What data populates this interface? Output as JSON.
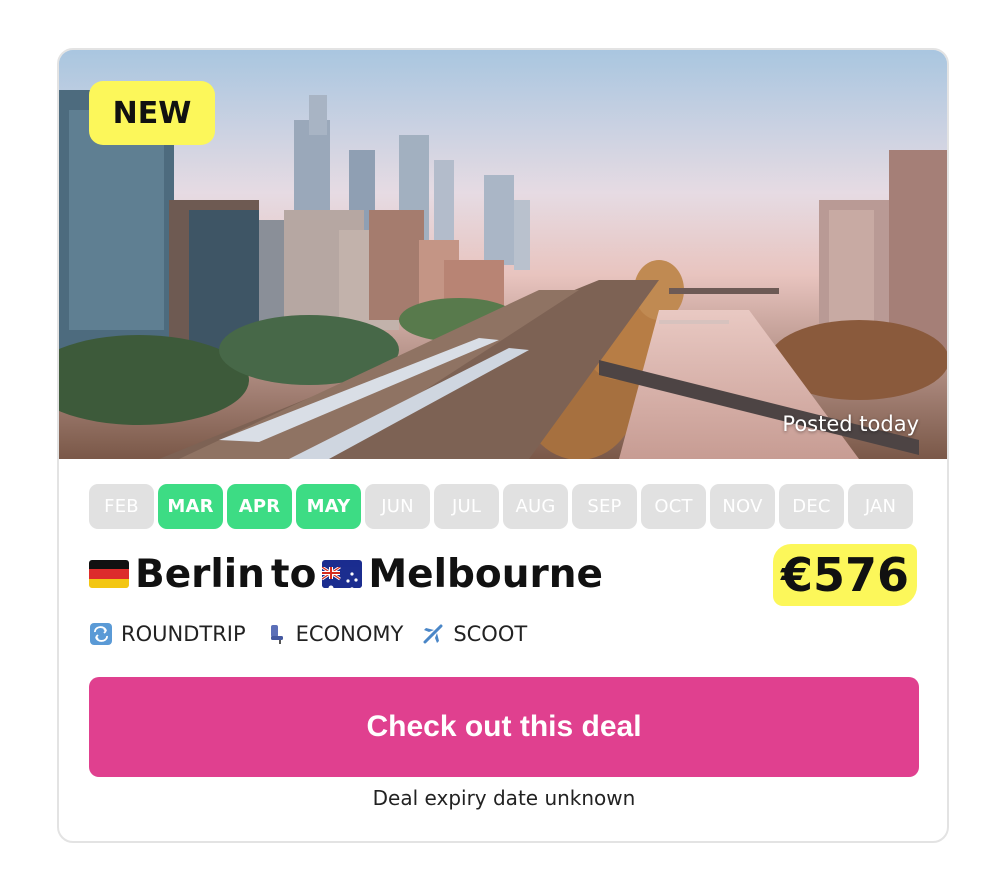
{
  "badge": {
    "label": "NEW"
  },
  "hero": {
    "posted": "Posted today",
    "image": "melbourne-city-river-photo"
  },
  "months": [
    {
      "label": "FEB",
      "active": false
    },
    {
      "label": "MAR",
      "active": true
    },
    {
      "label": "APR",
      "active": true
    },
    {
      "label": "MAY",
      "active": true
    },
    {
      "label": "JUN",
      "active": false
    },
    {
      "label": "JUL",
      "active": false
    },
    {
      "label": "AUG",
      "active": false
    },
    {
      "label": "SEP",
      "active": false
    },
    {
      "label": "OCT",
      "active": false
    },
    {
      "label": "NOV",
      "active": false
    },
    {
      "label": "DEC",
      "active": false
    },
    {
      "label": "JAN",
      "active": false
    }
  ],
  "route": {
    "origin": "Berlin",
    "connector": "to",
    "destination": "Melbourne",
    "origin_flag": "germany-flag-icon",
    "destination_flag": "australia-flag-icon"
  },
  "price": "€576",
  "meta": {
    "trip_type": "ROUNDTRIP",
    "cabin": "ECONOMY",
    "airline": "SCOOT"
  },
  "cta": {
    "label": "Check out this deal"
  },
  "expiry": "Deal expiry date unknown",
  "colors": {
    "active_month": "#3ddc84",
    "inactive_month": "#e1e1e1",
    "badge": "#fcf75a",
    "cta": "#e0408f"
  }
}
